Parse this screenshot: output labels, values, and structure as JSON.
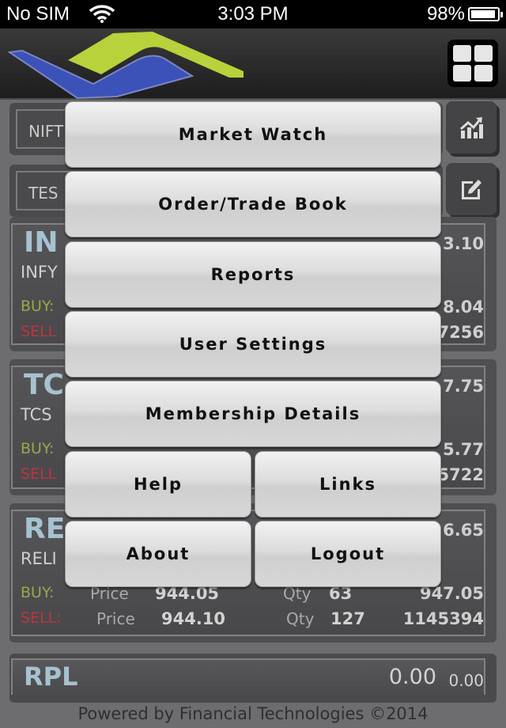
{
  "status_bar": {
    "carrier": "No SIM",
    "time": "3:03 PM",
    "battery_percent": "98%"
  },
  "header": {
    "logo": "financial-technologies-logo",
    "menu_icon": "grid-menu-icon"
  },
  "background": {
    "index_selector": {
      "label": "NIFT",
      "icon": "chart-icon"
    },
    "watchlist_selector": {
      "label": "TES",
      "icon": "edit-icon"
    },
    "scrips": [
      {
        "symbol": "IN",
        "name": "INFY",
        "ltp": "3.10",
        "buy_label": "BUY:",
        "sell_label": "SELL",
        "buy_right": "8.04",
        "sell_right": "7256"
      },
      {
        "symbol": "TC",
        "name": "TCS",
        "ltp": "7.75",
        "buy_label": "BUY:",
        "sell_label": "SELL",
        "buy_right": "5.77",
        "sell_right": "5722"
      },
      {
        "symbol": "RE",
        "name": "RELI",
        "ltp": "6.65",
        "buy_label": "BUY:",
        "sell_label": "SELL:",
        "buy_price_label": "Price",
        "buy_price": "944.05",
        "buy_qty_label": "Qty",
        "buy_qty": "63",
        "buy_right": "947.05",
        "sell_price_label": "Price",
        "sell_price": "944.10",
        "sell_qty_label": "Qty",
        "sell_qty": "127",
        "sell_right": "1145394"
      }
    ],
    "rpl": {
      "symbol": "RPL",
      "value": "0.00",
      "change": "0.00"
    },
    "footer": "Powered by Financial Technologies ©2014"
  },
  "menu": {
    "items": [
      {
        "label": "Market Watch"
      },
      {
        "label": "Order/Trade Book"
      },
      {
        "label": "Reports"
      },
      {
        "label": "User Settings"
      },
      {
        "label": "Membership Details"
      },
      {
        "label": "Help"
      },
      {
        "label": "Links"
      },
      {
        "label": "About"
      },
      {
        "label": "Logout"
      }
    ]
  }
}
